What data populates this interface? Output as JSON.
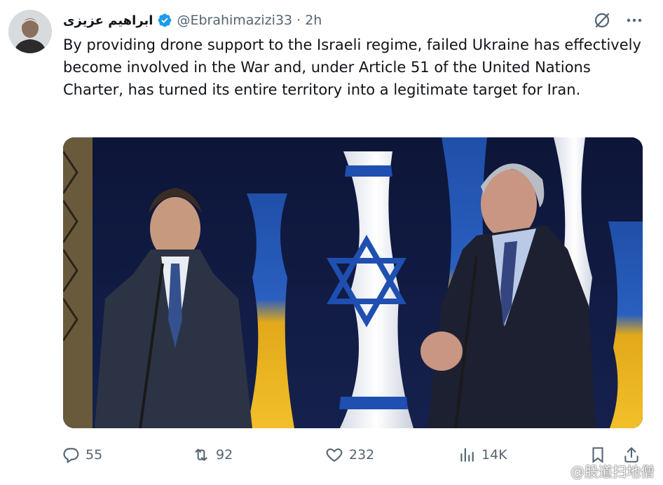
{
  "author": {
    "display_name": "ابراهیم عزیزی",
    "handle": "@Ebrahimazizi33",
    "separator": "·",
    "time": "2h",
    "verified": true
  },
  "tweet": {
    "text": "By providing drone support to the Israeli regime, failed Ukraine has effectively become involved in the War and, under Article 51 of the United Nations Charter, has turned its entire territory into a legitimate target for Iran."
  },
  "actions": {
    "replies": "55",
    "reposts": "92",
    "likes": "232",
    "views": "14K"
  },
  "icons": {
    "grok": "slashed-circle-icon",
    "more": "more-icon",
    "reply": "reply-icon",
    "repost": "repost-icon",
    "like": "heart-icon",
    "views": "views-icon",
    "bookmark": "bookmark-icon",
    "share": "share-icon"
  },
  "colors": {
    "verified": "#1d9bf0",
    "secondary_text": "#536471",
    "primary_text": "#0f1419"
  },
  "watermark": {
    "text": "@股道扫地僧"
  }
}
